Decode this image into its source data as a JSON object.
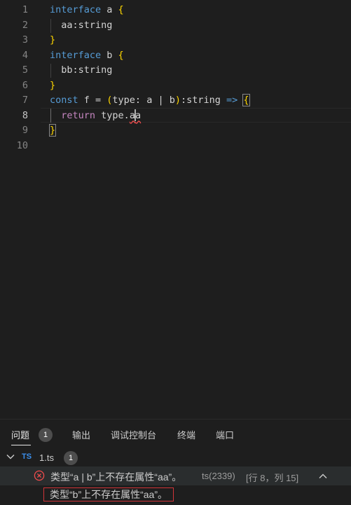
{
  "editor": {
    "active_line": "8",
    "lines": [
      {
        "no": "1",
        "tokens": [
          {
            "t": "interface",
            "c": "kw"
          },
          {
            "t": " a ",
            "c": ""
          },
          {
            "t": "{",
            "c": "brace1"
          }
        ]
      },
      {
        "no": "2",
        "tokens": [
          {
            "t": "  aa:string",
            "c": ""
          }
        ]
      },
      {
        "no": "3",
        "tokens": [
          {
            "t": "}",
            "c": "brace1"
          }
        ]
      },
      {
        "no": "4",
        "tokens": [
          {
            "t": "interface",
            "c": "kw"
          },
          {
            "t": " b ",
            "c": ""
          },
          {
            "t": "{",
            "c": "brace1"
          }
        ]
      },
      {
        "no": "5",
        "tokens": [
          {
            "t": "  bb:string",
            "c": ""
          }
        ]
      },
      {
        "no": "6",
        "tokens": [
          {
            "t": "}",
            "c": "brace1"
          }
        ]
      },
      {
        "no": "7",
        "tokens": [
          {
            "t": "const",
            "c": "kw"
          },
          {
            "t": " f = ",
            "c": ""
          },
          {
            "t": "(",
            "c": "brace1"
          },
          {
            "t": "type: a | b",
            "c": ""
          },
          {
            "t": ")",
            "c": "brace1"
          },
          {
            "t": ":string ",
            "c": ""
          },
          {
            "t": "=>",
            "c": "kw"
          },
          {
            "t": " ",
            "c": ""
          },
          {
            "t": "{",
            "c": "brace-match"
          }
        ]
      },
      {
        "no": "8",
        "tokens": [
          {
            "t": "  ",
            "c": ""
          },
          {
            "t": "return",
            "c": "ctl"
          },
          {
            "t": " type.",
            "c": ""
          },
          {
            "t": "a",
            "c": "err-underline"
          },
          {
            "t": "|",
            "c": "cursor"
          },
          {
            "t": "a",
            "c": "err-underline"
          }
        ]
      },
      {
        "no": "9",
        "tokens": [
          {
            "t": "}",
            "c": "brace-match"
          }
        ]
      },
      {
        "no": "10",
        "tokens": []
      }
    ]
  },
  "panel": {
    "tabs": [
      {
        "label": "问题",
        "active": true
      },
      {
        "label": "输出",
        "active": false
      },
      {
        "label": "调试控制台",
        "active": false
      },
      {
        "label": "终端",
        "active": false
      },
      {
        "label": "端口",
        "active": false
      }
    ],
    "problems_count": "1",
    "file": {
      "icon_text": "TS",
      "name": "1.ts",
      "count": "1"
    },
    "problem": {
      "message": "类型“a | b”上不存在属性“aa”。",
      "source": "ts(2339)",
      "location": "[行 8，列 15]"
    },
    "related": {
      "message": "类型“b”上不存在属性“aa”。"
    },
    "icons": {
      "chevron": "chevron-down-icon",
      "error": "error-circle-icon",
      "collapse": "chevron-up-icon"
    },
    "colors": {
      "error": "#f14c4c",
      "ts_blue": "#3b8eea",
      "keyword": "#569cd6",
      "control": "#c586c0",
      "bracket": "#ffd700"
    }
  }
}
